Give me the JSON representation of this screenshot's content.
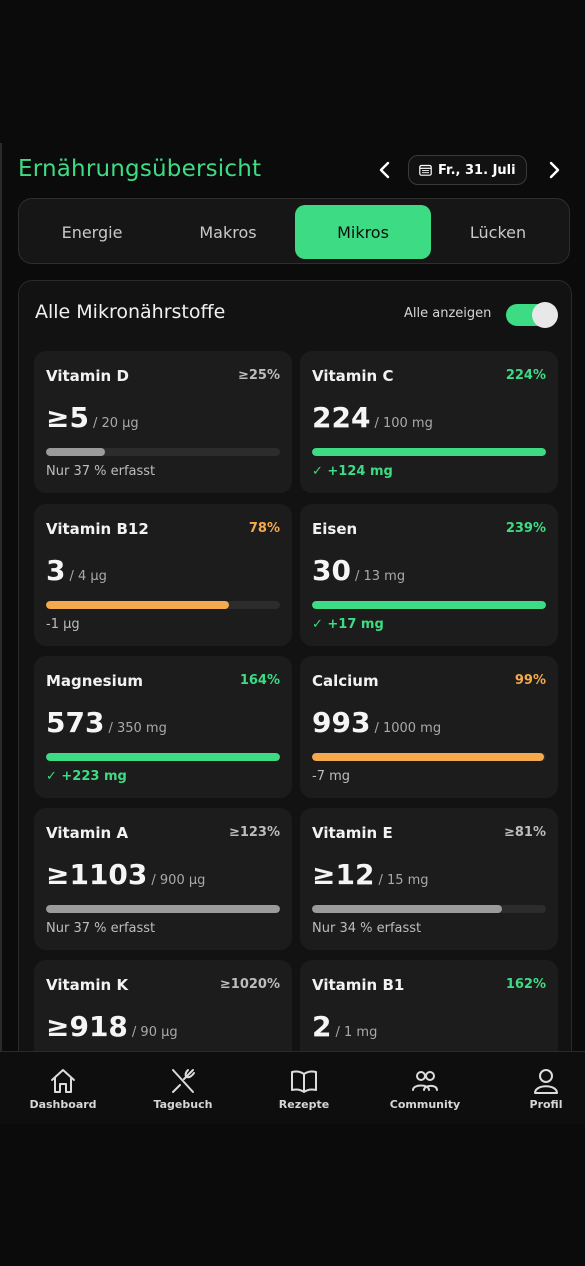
{
  "header": {
    "title": "Ernährungsübersicht",
    "date": "Fr., 31. Juli",
    "prev_icon": "chevron-left-icon",
    "next_icon": "chevron-right-icon",
    "calendar_icon": "calendar-icon"
  },
  "tabs": [
    {
      "label": "Energie",
      "active": false
    },
    {
      "label": "Makros",
      "active": false
    },
    {
      "label": "Mikros",
      "active": true
    },
    {
      "label": "Lücken",
      "active": false
    }
  ],
  "panel": {
    "title": "Alle Mikronährstoffe",
    "toggle_label": "Alle anzeigen",
    "toggle_on": true
  },
  "colors": {
    "accent": "#3ddc84",
    "warning": "#f4a94c",
    "neutral": "#9b9b9b",
    "neutral_text": "#bdbdbd"
  },
  "nutrients": [
    {
      "name": "Vitamin D",
      "pct": "≥25%",
      "value": "≥5",
      "unit": "/ 20 µg",
      "progress": 0.25,
      "status": "neutral",
      "note": "Nur 37 % erfasst"
    },
    {
      "name": "Vitamin C",
      "pct": "224%",
      "value": "224",
      "unit": "/ 100 mg",
      "progress": 1.0,
      "status": "good",
      "note": "✓ +124 mg"
    },
    {
      "name": "Vitamin B12",
      "pct": "78%",
      "value": "3",
      "unit": "/ 4 µg",
      "progress": 0.78,
      "status": "warn",
      "note": "-1 µg"
    },
    {
      "name": "Eisen",
      "pct": "239%",
      "value": "30",
      "unit": "/ 13 mg",
      "progress": 1.0,
      "status": "good",
      "note": "✓ +17 mg"
    },
    {
      "name": "Magnesium",
      "pct": "164%",
      "value": "573",
      "unit": "/ 350 mg",
      "progress": 1.0,
      "status": "good",
      "note": "✓ +223 mg"
    },
    {
      "name": "Calcium",
      "pct": "99%",
      "value": "993",
      "unit": "/ 1000 mg",
      "progress": 0.99,
      "status": "warn",
      "note": "-7 mg"
    },
    {
      "name": "Vitamin A",
      "pct": "≥123%",
      "value": "≥1103",
      "unit": "/ 900 µg",
      "progress": 1.0,
      "status": "neutral",
      "note": "Nur 37 % erfasst"
    },
    {
      "name": "Vitamin E",
      "pct": "≥81%",
      "value": "≥12",
      "unit": "/ 15 mg",
      "progress": 0.81,
      "status": "neutral",
      "note": "Nur 34 % erfasst"
    },
    {
      "name": "Vitamin K",
      "pct": "≥1020%",
      "value": "≥918",
      "unit": "/ 90 µg",
      "progress": 1.0,
      "status": "neutral",
      "note": ""
    },
    {
      "name": "Vitamin B1",
      "pct": "162%",
      "value": "2",
      "unit": "/ 1 mg",
      "progress": 1.0,
      "status": "good",
      "note": ""
    }
  ],
  "nav": [
    {
      "label": "Dashboard",
      "icon": "home-icon"
    },
    {
      "label": "Tagebuch",
      "icon": "utensils-icon"
    },
    {
      "label": "Rezepte",
      "icon": "book-icon"
    },
    {
      "label": "Community",
      "icon": "users-icon"
    },
    {
      "label": "Profil",
      "icon": "user-icon"
    }
  ]
}
